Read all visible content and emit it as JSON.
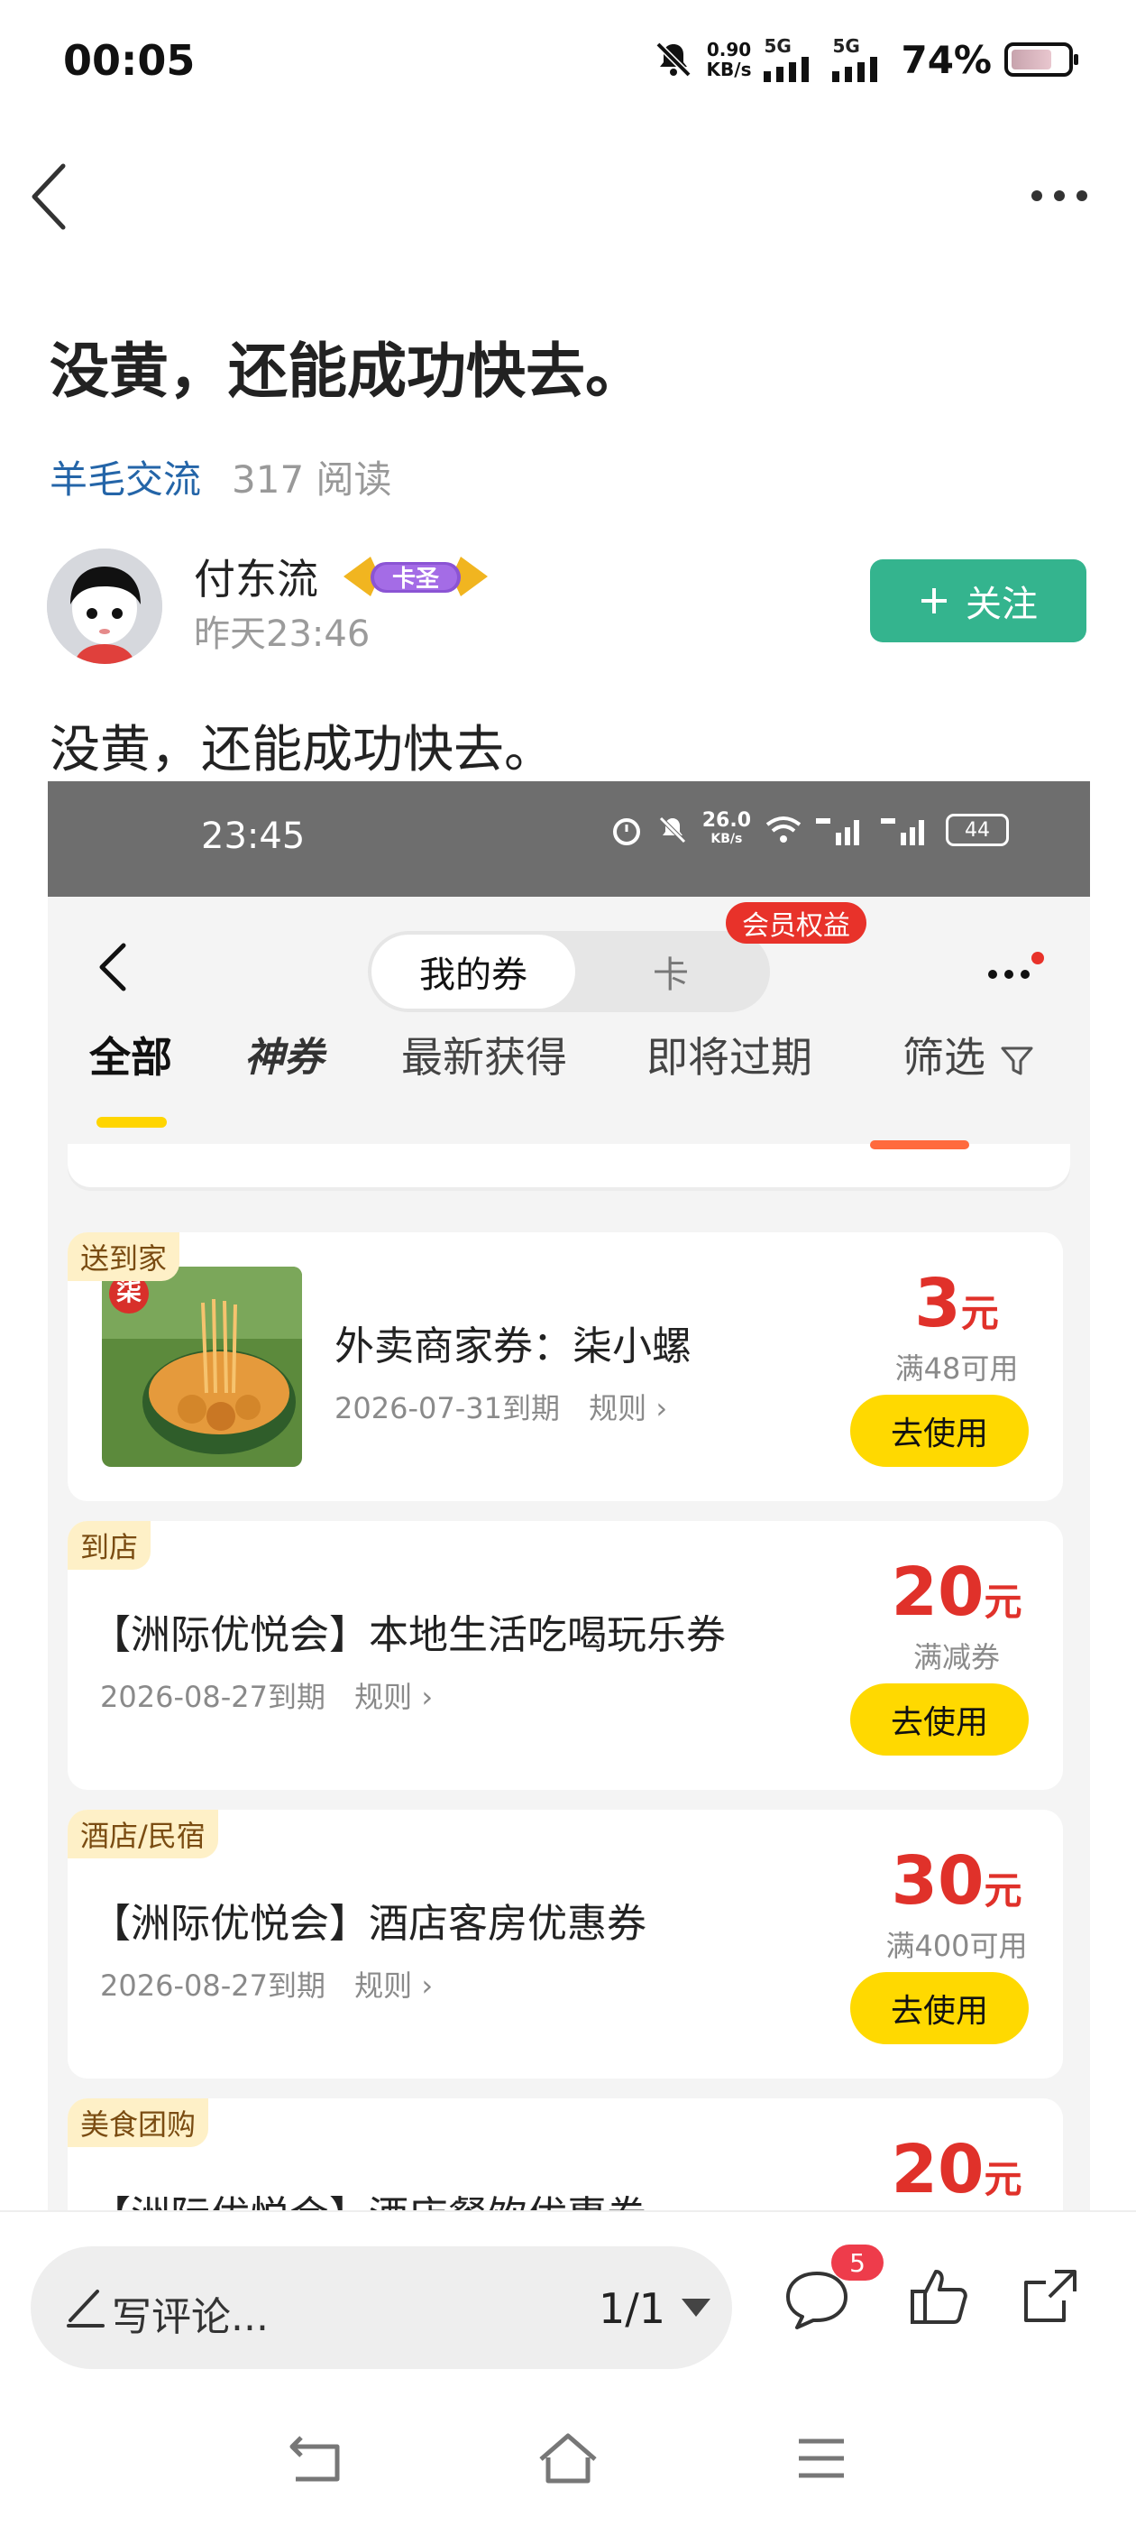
{
  "status_bar": {
    "time": "00:05",
    "speed_value": "0.90",
    "speed_unit": "KB/s",
    "net1": "5G",
    "net2": "5G",
    "battery": "74%"
  },
  "header": {
    "back_icon": "chevron-left-icon",
    "more_icon": "more-dots-icon"
  },
  "post": {
    "title": "没黄，还能成功快去。",
    "category": "羊毛交流",
    "reads": "317 阅读",
    "author": "付东流",
    "badge": "卡圣",
    "time": "昨天23:46",
    "follow_label": "关注",
    "body": "没黄，还能成功快去。"
  },
  "embedded": {
    "status_time": "23:45",
    "status_speed": "26.0",
    "status_speed_unit": "KB/s",
    "battery": "44",
    "seg_active": "我的券",
    "seg_inactive": "卡",
    "vip_pill": "会员权益",
    "tabs": [
      "全部",
      "神券",
      "最新获得",
      "即将过期",
      "筛选"
    ],
    "coupons": [
      {
        "tag": "送到家",
        "name": "外卖商家券：柒小螺",
        "expire": "2026-07-31到期",
        "rule": "规则",
        "amount": "3",
        "unit": "元",
        "condition": "满48可用",
        "button": "去使用",
        "thumb_text": "柒"
      },
      {
        "tag": "到店",
        "name": "【洲际优悦会】本地生活吃喝玩乐券",
        "expire": "2026-08-27到期",
        "rule": "规则",
        "amount": "20",
        "unit": "元",
        "condition": "满减券",
        "button": "去使用"
      },
      {
        "tag": "酒店/民宿",
        "name": "【洲际优悦会】酒店客房优惠券",
        "expire": "2026-08-27到期",
        "rule": "规则",
        "amount": "30",
        "unit": "元",
        "condition": "满400可用",
        "button": "去使用"
      },
      {
        "tag": "美食团购",
        "name": "【洲际优悦会】酒店餐饮优惠券",
        "amount": "20",
        "unit": "元"
      }
    ]
  },
  "bottom": {
    "comment_placeholder": "写评论...",
    "page": "1/1",
    "comment_count": "5"
  },
  "colors": {
    "accent_green": "#34b48e",
    "link_blue": "#2465a8",
    "coupon_red": "#e0312a",
    "button_yellow": "#ffd900"
  }
}
